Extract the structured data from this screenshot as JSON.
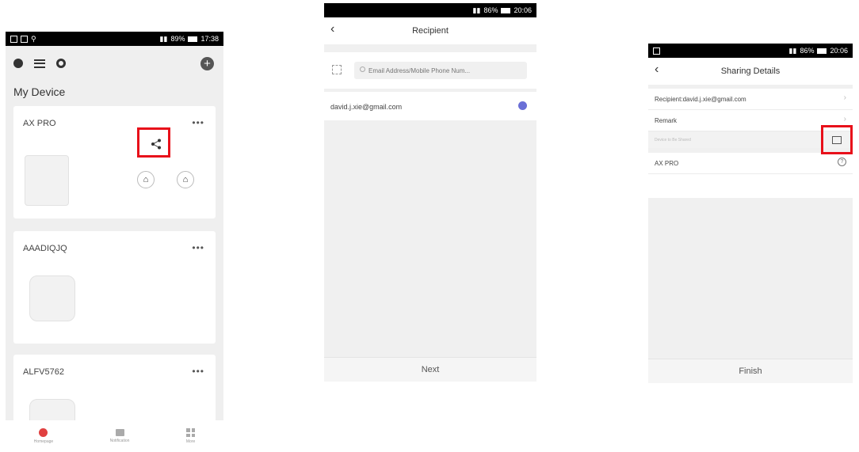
{
  "screen1": {
    "status_time": "17:38",
    "status_battery": "89%",
    "title": "My Device",
    "devices": [
      {
        "name": "AX PRO",
        "more": "•••"
      },
      {
        "name": "AAADIQJQ",
        "more": "•••"
      },
      {
        "name": "ALFV5762",
        "more": "•••"
      }
    ],
    "tabs": [
      {
        "label": "Homepage"
      },
      {
        "label": "Notification"
      },
      {
        "label": "More"
      }
    ],
    "highlight_color": "#e8101a"
  },
  "screen2": {
    "status_time": "20:06",
    "status_battery": "86%",
    "title": "Recipient",
    "search_placeholder": "Email Address/Mobile Phone Num...",
    "recipient_email": "david.j.xie@gmail.com",
    "next_label": "Next"
  },
  "screen3": {
    "status_time": "20:06",
    "status_battery": "86%",
    "title": "Sharing Details",
    "recipient_row": "Recipient:david.j.xie@gmail.com",
    "remark_label": "Remark",
    "section_header": "Device to Be Shared",
    "device_name": "AX PRO",
    "finish_label": "Finish"
  }
}
